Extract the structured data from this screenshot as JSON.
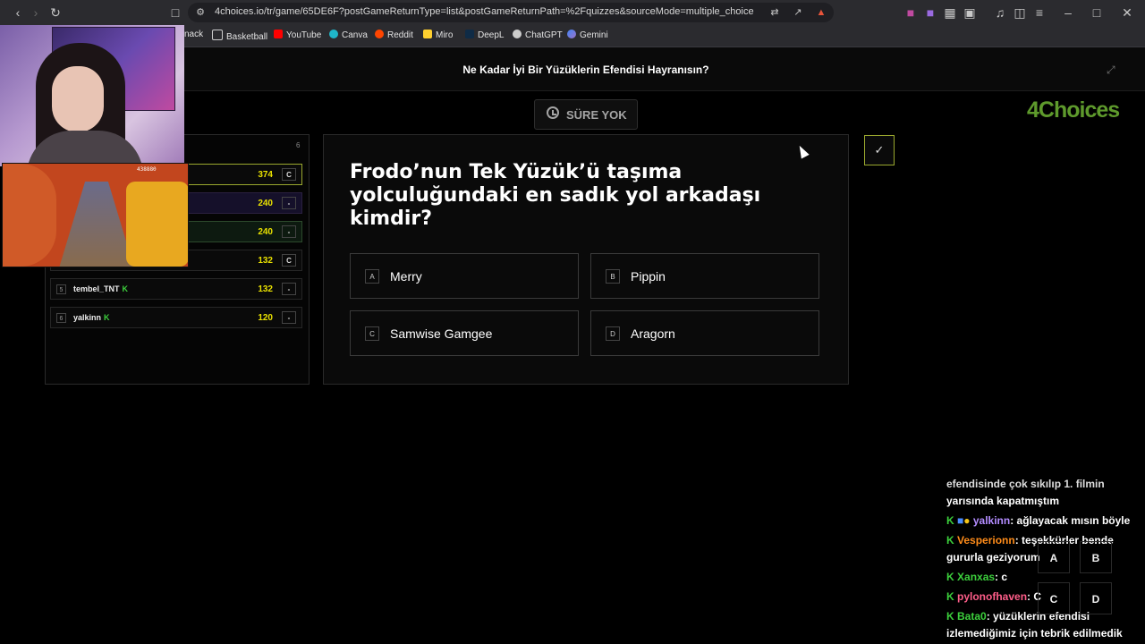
{
  "browser": {
    "url": "4choices.io/tr/game/65DE6F?postGameReturnType=list&postGameReturnPath=%2Fquizzes&sourceMode=multiple_choice",
    "bookmarks": [
      "nack",
      "Basketball",
      "YouTube",
      "Canva",
      "Reddit",
      "Miro",
      "DeepL",
      "ChatGPT",
      "Gemini"
    ]
  },
  "page": {
    "title": "Ne Kadar İyi Bir Yüzüklerin Efendisi Hayranısın?",
    "timer_label": "SÜRE YOK",
    "logo": "4Choices"
  },
  "leaderboard": {
    "header_count": "6",
    "rows": [
      {
        "rank": "",
        "name": "",
        "score": "374",
        "answer": "C"
      },
      {
        "rank": "",
        "name": "",
        "score": "240",
        "answer": "-"
      },
      {
        "rank": "",
        "name": "",
        "score": "240",
        "answer": "-"
      },
      {
        "rank": "",
        "name": "",
        "score": "132",
        "answer": "C"
      },
      {
        "rank": "5",
        "name": "tembel_TNT",
        "badge": "K",
        "score": "132",
        "answer": "-"
      },
      {
        "rank": "6",
        "name": "yalkinn",
        "badge": "K",
        "score": "120",
        "answer": "-"
      }
    ]
  },
  "question": {
    "text": "Frodo’nun Tek Yüzük’ü taşıma yolculuğundaki en sadık yol arkadaşı kimdir?",
    "options": [
      {
        "letter": "A",
        "text": "Merry"
      },
      {
        "letter": "B",
        "text": "Pippin"
      },
      {
        "letter": "C",
        "text": "Samwise Gamgee"
      },
      {
        "letter": "D",
        "text": "Aragorn"
      }
    ]
  },
  "check_icon": "✓",
  "game_hud": "438880",
  "chat": {
    "partial_top": "efendisinde çok sıkılıp 1. filmin",
    "partial_second": "yarısında kapatmıştım",
    "messages": [
      {
        "user": "yalkinn",
        "color": "#b38cff",
        "text": ": ağlayacak mısın böyle"
      },
      {
        "user": "Vesperionn",
        "color": "#ff8c1a",
        "text": ": teşekkürler bende"
      },
      {
        "user": "",
        "color": "#ffffff",
        "text": "gururla geziyorum"
      },
      {
        "user": "Xanxas",
        "color": "#3ccf3c",
        "text": ": c"
      },
      {
        "user": "pylonofhaven",
        "color": "#ff5e8a",
        "text": ": C"
      },
      {
        "user": "Bata0",
        "color": "#3ccf3c",
        "text": ": yüzüklerin efendisi"
      },
      {
        "user": "",
        "color": "#ffffff",
        "text": "izlemediğimiz için tebrik edilmedik"
      }
    ],
    "answer_buttons": [
      "A",
      "B",
      "C",
      "D"
    ]
  }
}
